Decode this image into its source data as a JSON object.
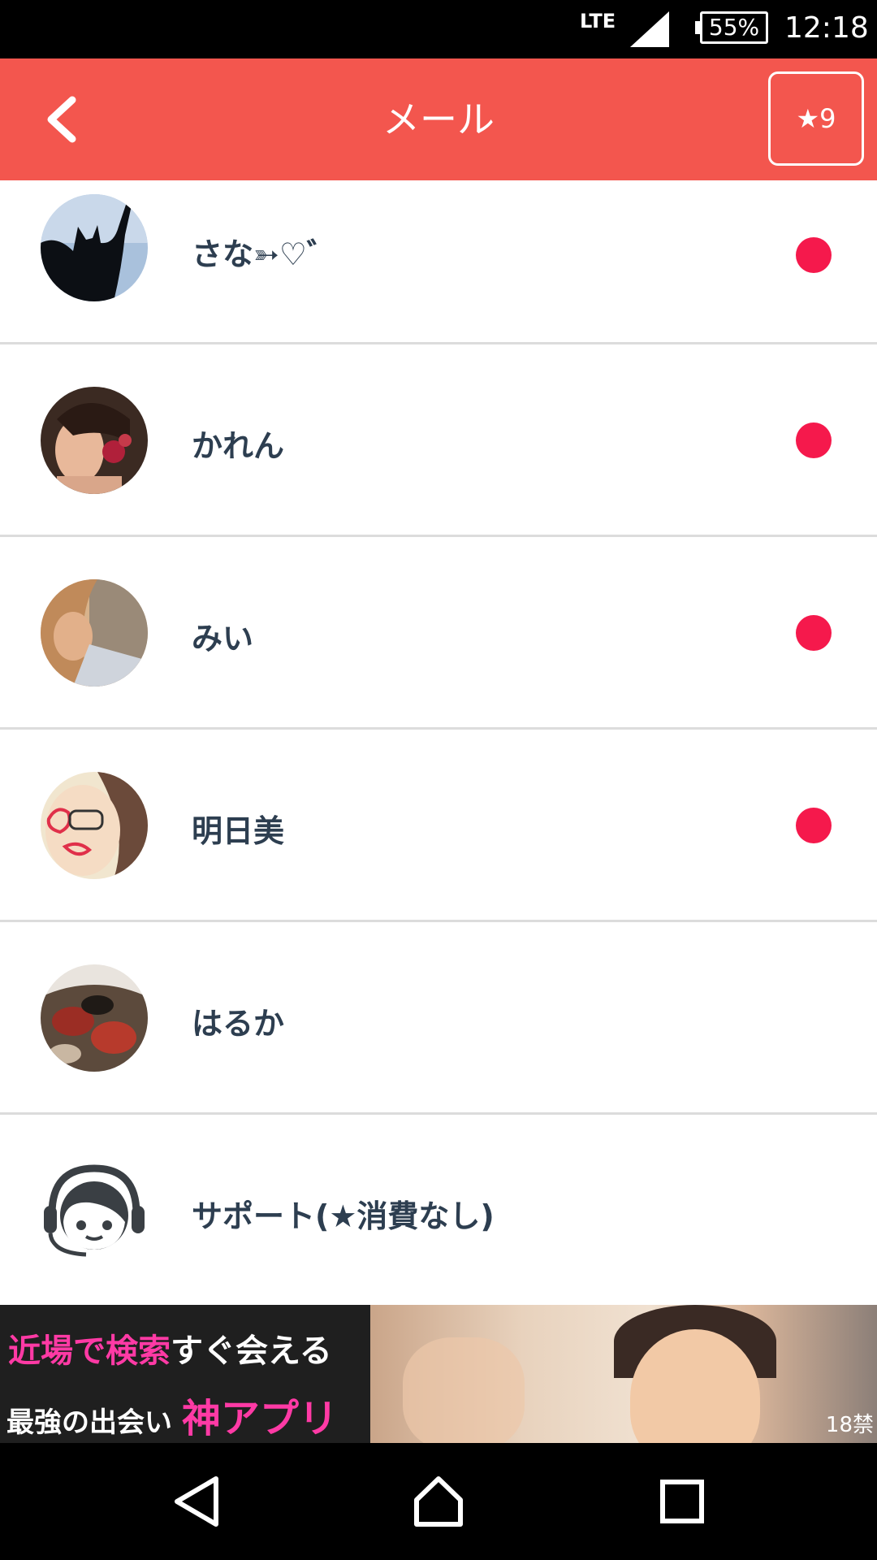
{
  "status_bar": {
    "network": "LTE",
    "battery": "55%",
    "time": "12:18"
  },
  "header": {
    "title": "メール",
    "star_badge": "★9"
  },
  "messages": [
    {
      "name": "さな➳♡゛",
      "unread": true,
      "avatar": "cat-silhouette-photo"
    },
    {
      "name": "かれん",
      "unread": true,
      "avatar": "woman-portrait-photo"
    },
    {
      "name": "みい",
      "unread": true,
      "avatar": "woman-photo"
    },
    {
      "name": "明日美",
      "unread": true,
      "avatar": "woman-glasses-photo"
    },
    {
      "name": "はるか",
      "unread": false,
      "avatar": "camo-jacket-photo"
    },
    {
      "name": "サポート(★消費なし)",
      "unread": false,
      "avatar": "support-headset-icon"
    }
  ],
  "banner": {
    "line1_pink": "近場で検索",
    "line1_white": "すぐ会える",
    "line2_white": "最強の出会い",
    "line2_pink": "神アプリ",
    "age_label": "18禁"
  },
  "colors": {
    "header": "#f3564e",
    "unread_dot": "#f5194c",
    "name_text": "#2d3e50",
    "banner_pink": "#ff3aa5"
  }
}
